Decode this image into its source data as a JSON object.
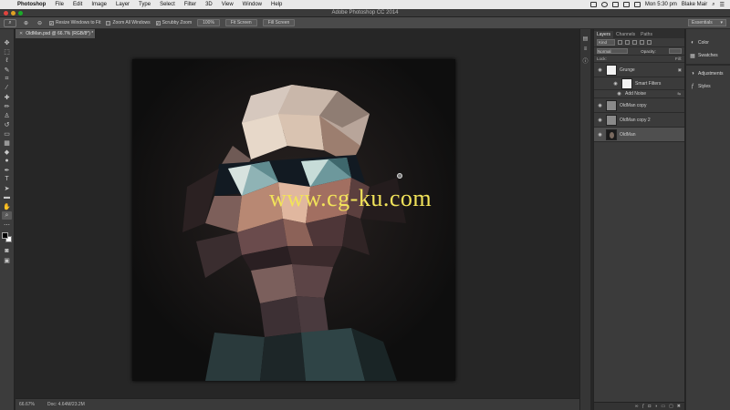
{
  "menubar": {
    "app_name": "Photoshop",
    "items": [
      "File",
      "Edit",
      "Image",
      "Layer",
      "Type",
      "Select",
      "Filter",
      "3D",
      "View",
      "Window",
      "Help"
    ],
    "clock": "Mon 5:30 pm",
    "user": "Blake Mair"
  },
  "window": {
    "title": "Adobe Photoshop CC 2014"
  },
  "options": {
    "resize_windows": "Resize Windows to Fit",
    "zoom_all": "Zoom All Windows",
    "scrubby_zoom": "Scrubby Zoom",
    "btn_100": "100%",
    "btn_fit": "Fit Screen",
    "btn_fill": "Fill Screen",
    "workspace": "Essentials"
  },
  "document": {
    "tab_label": "OldMan.psd @ 66.7% (RGB/8*) *",
    "watermark": "www.cg-ku.com"
  },
  "status": {
    "zoom": "66.67%",
    "doc_size": "Doc: 4.64M/23.2M"
  },
  "layers_panel": {
    "tabs": [
      "Layers",
      "Channels",
      "Paths"
    ],
    "filter_kind": "Kind",
    "blend_mode": "Normal",
    "opacity_label": "Opacity:",
    "fill_label": "Fill:",
    "lock_label": "Lock:",
    "layers": [
      {
        "name": "Grunge"
      },
      {
        "name": "OldMan copy"
      },
      {
        "name": "OldMan copy 2"
      },
      {
        "name": "OldMan"
      }
    ],
    "smart_filters": "Smart Filters",
    "add_noise": "Add Noise"
  },
  "mini_panels": {
    "items": [
      "Color",
      "Swatches",
      "Adjustments",
      "Styles"
    ]
  },
  "colors": {
    "accent_watermark": "#f2e35a"
  }
}
